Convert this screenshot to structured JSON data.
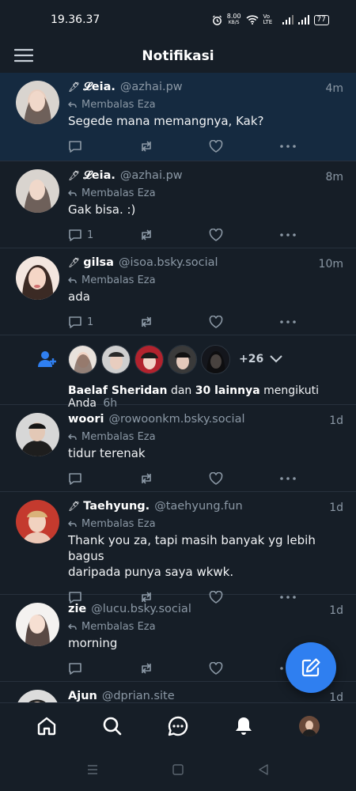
{
  "status_bar": {
    "time": "19.36.37",
    "net_speed_value": "8.00",
    "net_speed_unit": "KB/S",
    "volte": "Vo LTE",
    "battery": "77"
  },
  "header": {
    "title": "Notifikasi"
  },
  "notifications": [
    {
      "pin": "🖋",
      "name": "𝓛eia.",
      "handle": "@azhai.pw",
      "time": "4m",
      "reply_label": "Membalas Eza",
      "text": "Segede mana memangnya, Kak?",
      "reply_count": "",
      "highlighted": true
    },
    {
      "pin": "🖋",
      "name": "𝓛eia.",
      "handle": "@azhai.pw",
      "time": "8m",
      "reply_label": "Membalas Eza",
      "text": "Gak bisa. :)",
      "reply_count": "1"
    },
    {
      "pin": "🖋",
      "name": "gilsa",
      "handle": "@isoa.bsky.social",
      "time": "10m",
      "reply_label": "Membalas Eza",
      "text": "ada",
      "reply_count": "1"
    },
    {
      "name": "woori",
      "handle": "@rowoonkm.bsky.social",
      "time": "1d",
      "reply_label": "Membalas Eza",
      "text": "tidur terenak",
      "reply_count": ""
    },
    {
      "pin": "🖋",
      "name": "Taehyung.",
      "handle": "@taehyung.fun",
      "time": "1d",
      "reply_label": "Membalas Eza",
      "text_line1": "Thank you za, tapi masih banyak yg lebih bagus",
      "text_line2": "daripada punya saya wkwk.",
      "reply_count": ""
    },
    {
      "name": "zie",
      "handle": "@lucu.bsky.social",
      "time": "1d",
      "reply_label": "Membalas Eza",
      "text": "morning",
      "reply_count": ""
    },
    {
      "name": "Ajun",
      "handle": "@dprian.site",
      "time": "1d"
    }
  ],
  "follow": {
    "more_count": "+26",
    "first_name": "Baelaf Sheridan",
    "connector": "dan",
    "others": "30 lainnya",
    "action": "mengikuti Anda",
    "time": "6h"
  },
  "colors": {
    "background": "#161e27",
    "highlight": "#152a40",
    "accent": "#2f7ff0",
    "muted": "#8b98a5"
  },
  "icons": [
    "menu-icon",
    "reply-icon",
    "repost-icon",
    "heart-icon",
    "more-icon",
    "follow-icon",
    "compose-icon",
    "home-icon",
    "search-icon",
    "chat-icon",
    "bell-icon"
  ]
}
